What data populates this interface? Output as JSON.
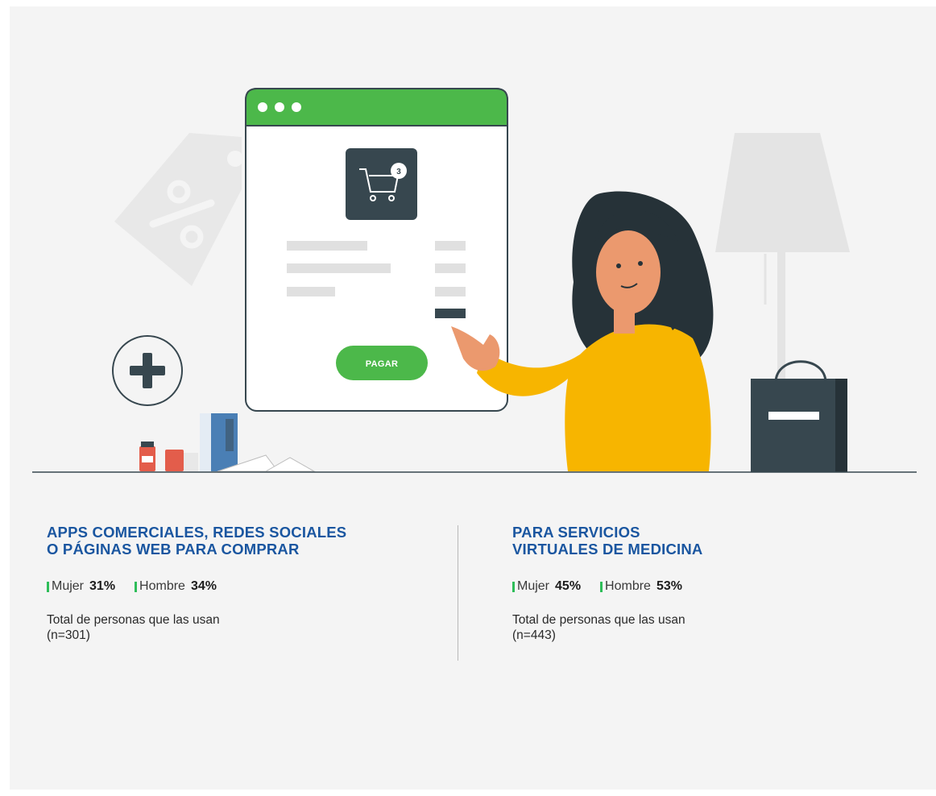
{
  "illustration": {
    "browser": {
      "cart_badge": "3",
      "pay_button_label": "PAGAR"
    },
    "colors": {
      "browser_header": "#4cb84a",
      "pay_button": "#4cb84a",
      "sweater": "#f7b500",
      "hair": "#263238",
      "skin": "#eb996e",
      "dark_slate": "#37474f"
    }
  },
  "sections": [
    {
      "heading_lines": [
        "APPS COMERCIALES, REDES SOCIALES",
        "O PÁGINAS WEB PARA COMPRAR"
      ],
      "women_label": "Mujer",
      "women_value": "31%",
      "men_label": "Hombre",
      "men_value": "34%",
      "total_line1": "Total de personas que las usan",
      "total_line2": "(n=301)"
    },
    {
      "heading_lines": [
        "PARA SERVICIOS",
        "VIRTUALES DE MEDICINA"
      ],
      "women_label": "Mujer",
      "women_value": "45%",
      "men_label": "Hombre",
      "men_value": "53%",
      "total_line1": "Total de personas que las usan",
      "total_line2": "(n=443)"
    }
  ],
  "theme": {
    "heading_color": "#1a56a0",
    "marker_color": "#2ebd59",
    "background": "#f4f4f4"
  }
}
